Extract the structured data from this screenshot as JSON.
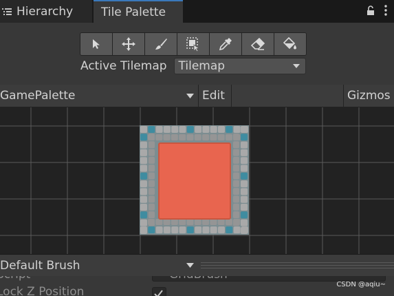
{
  "tabs": {
    "hierarchy": "Hierarchy",
    "tile_palette": "Tile Palette"
  },
  "tools": [
    {
      "name": "select-tool-icon"
    },
    {
      "name": "move-tool-icon"
    },
    {
      "name": "paint-brush-tool-icon"
    },
    {
      "name": "box-fill-tool-icon"
    },
    {
      "name": "picker-tool-icon"
    },
    {
      "name": "eraser-tool-icon"
    },
    {
      "name": "fill-tool-icon"
    }
  ],
  "active_tilemap": {
    "label": "Active Tilemap",
    "value": "Tilemap"
  },
  "palette_toolbar": {
    "palette_name": "GamePalette",
    "edit_label": "Edit",
    "gizmos_label": "Gizmos"
  },
  "brush": {
    "name": "Default Brush"
  },
  "inspector": {
    "script_label": "Script",
    "script_value": "GridBrush",
    "lock_z_label": "Lock Z Position",
    "lock_z_checked": true
  },
  "watermark": "CSDN @aqiu~",
  "colors": {
    "accent": "#3a79bb",
    "tile_fill": "#e8654f",
    "tile_border": "#a7a7a7"
  }
}
